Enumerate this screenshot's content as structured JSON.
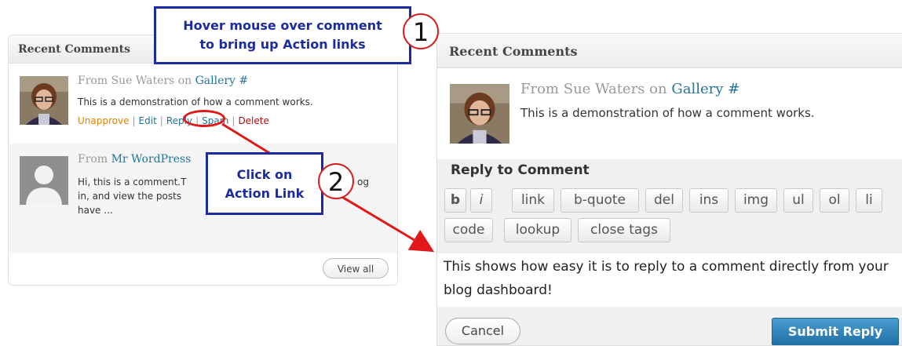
{
  "left_widget": {
    "title": "Recent Comments",
    "comment1": {
      "from_label": "From",
      "author": "Sue Waters",
      "on_label": "on",
      "post": "Gallery #",
      "text": "This is a demonstration of how a comment works.",
      "actions": [
        "Unapprove",
        "Edit",
        "Reply",
        "Spam",
        "Delete"
      ]
    },
    "comment2": {
      "from_label": "From",
      "author": "Mr WordPress",
      "line1": "Hi, this is a comment.T",
      "line1_end": "og",
      "line2": "in, and view the posts",
      "line3": "have ..."
    },
    "view_all": "View all"
  },
  "right_panel": {
    "title": "Recent Comments",
    "comment": {
      "from_label": "From",
      "author": "Sue Waters",
      "on_label": "on",
      "post": "Gallery #",
      "text": "This is a demonstration of how a comment works."
    },
    "reply_title": "Reply to Comment",
    "quicktags_row1": [
      "b",
      "i",
      "link",
      "b-quote",
      "del",
      "ins",
      "img",
      "ul",
      "ol",
      "li"
    ],
    "quicktags_row2": [
      "code",
      "lookup",
      "close tags"
    ],
    "reply_text": "This shows how easy it is to reply to a comment directly from your blog dashboard!",
    "cancel": "Cancel",
    "submit": "Submit Reply"
  },
  "callouts": {
    "step1_text_line1": "Hover mouse over comment",
    "step1_text_line2": "to bring up Action links",
    "step1_number": "1",
    "step2_text_line1": "Click on",
    "step2_text_line2": "Action Link",
    "step2_number": "2"
  },
  "colors": {
    "callout_border": "#1c2ba0",
    "arrow": "#e01818",
    "link": "#21759b",
    "unapprove": "#d98500",
    "delete": "#bc0b0b",
    "submit_bg": "#2a7ab5"
  },
  "icons": {
    "avatar_photo": "user-photo-avatar",
    "avatar_default": "default-mystery-person-avatar"
  }
}
